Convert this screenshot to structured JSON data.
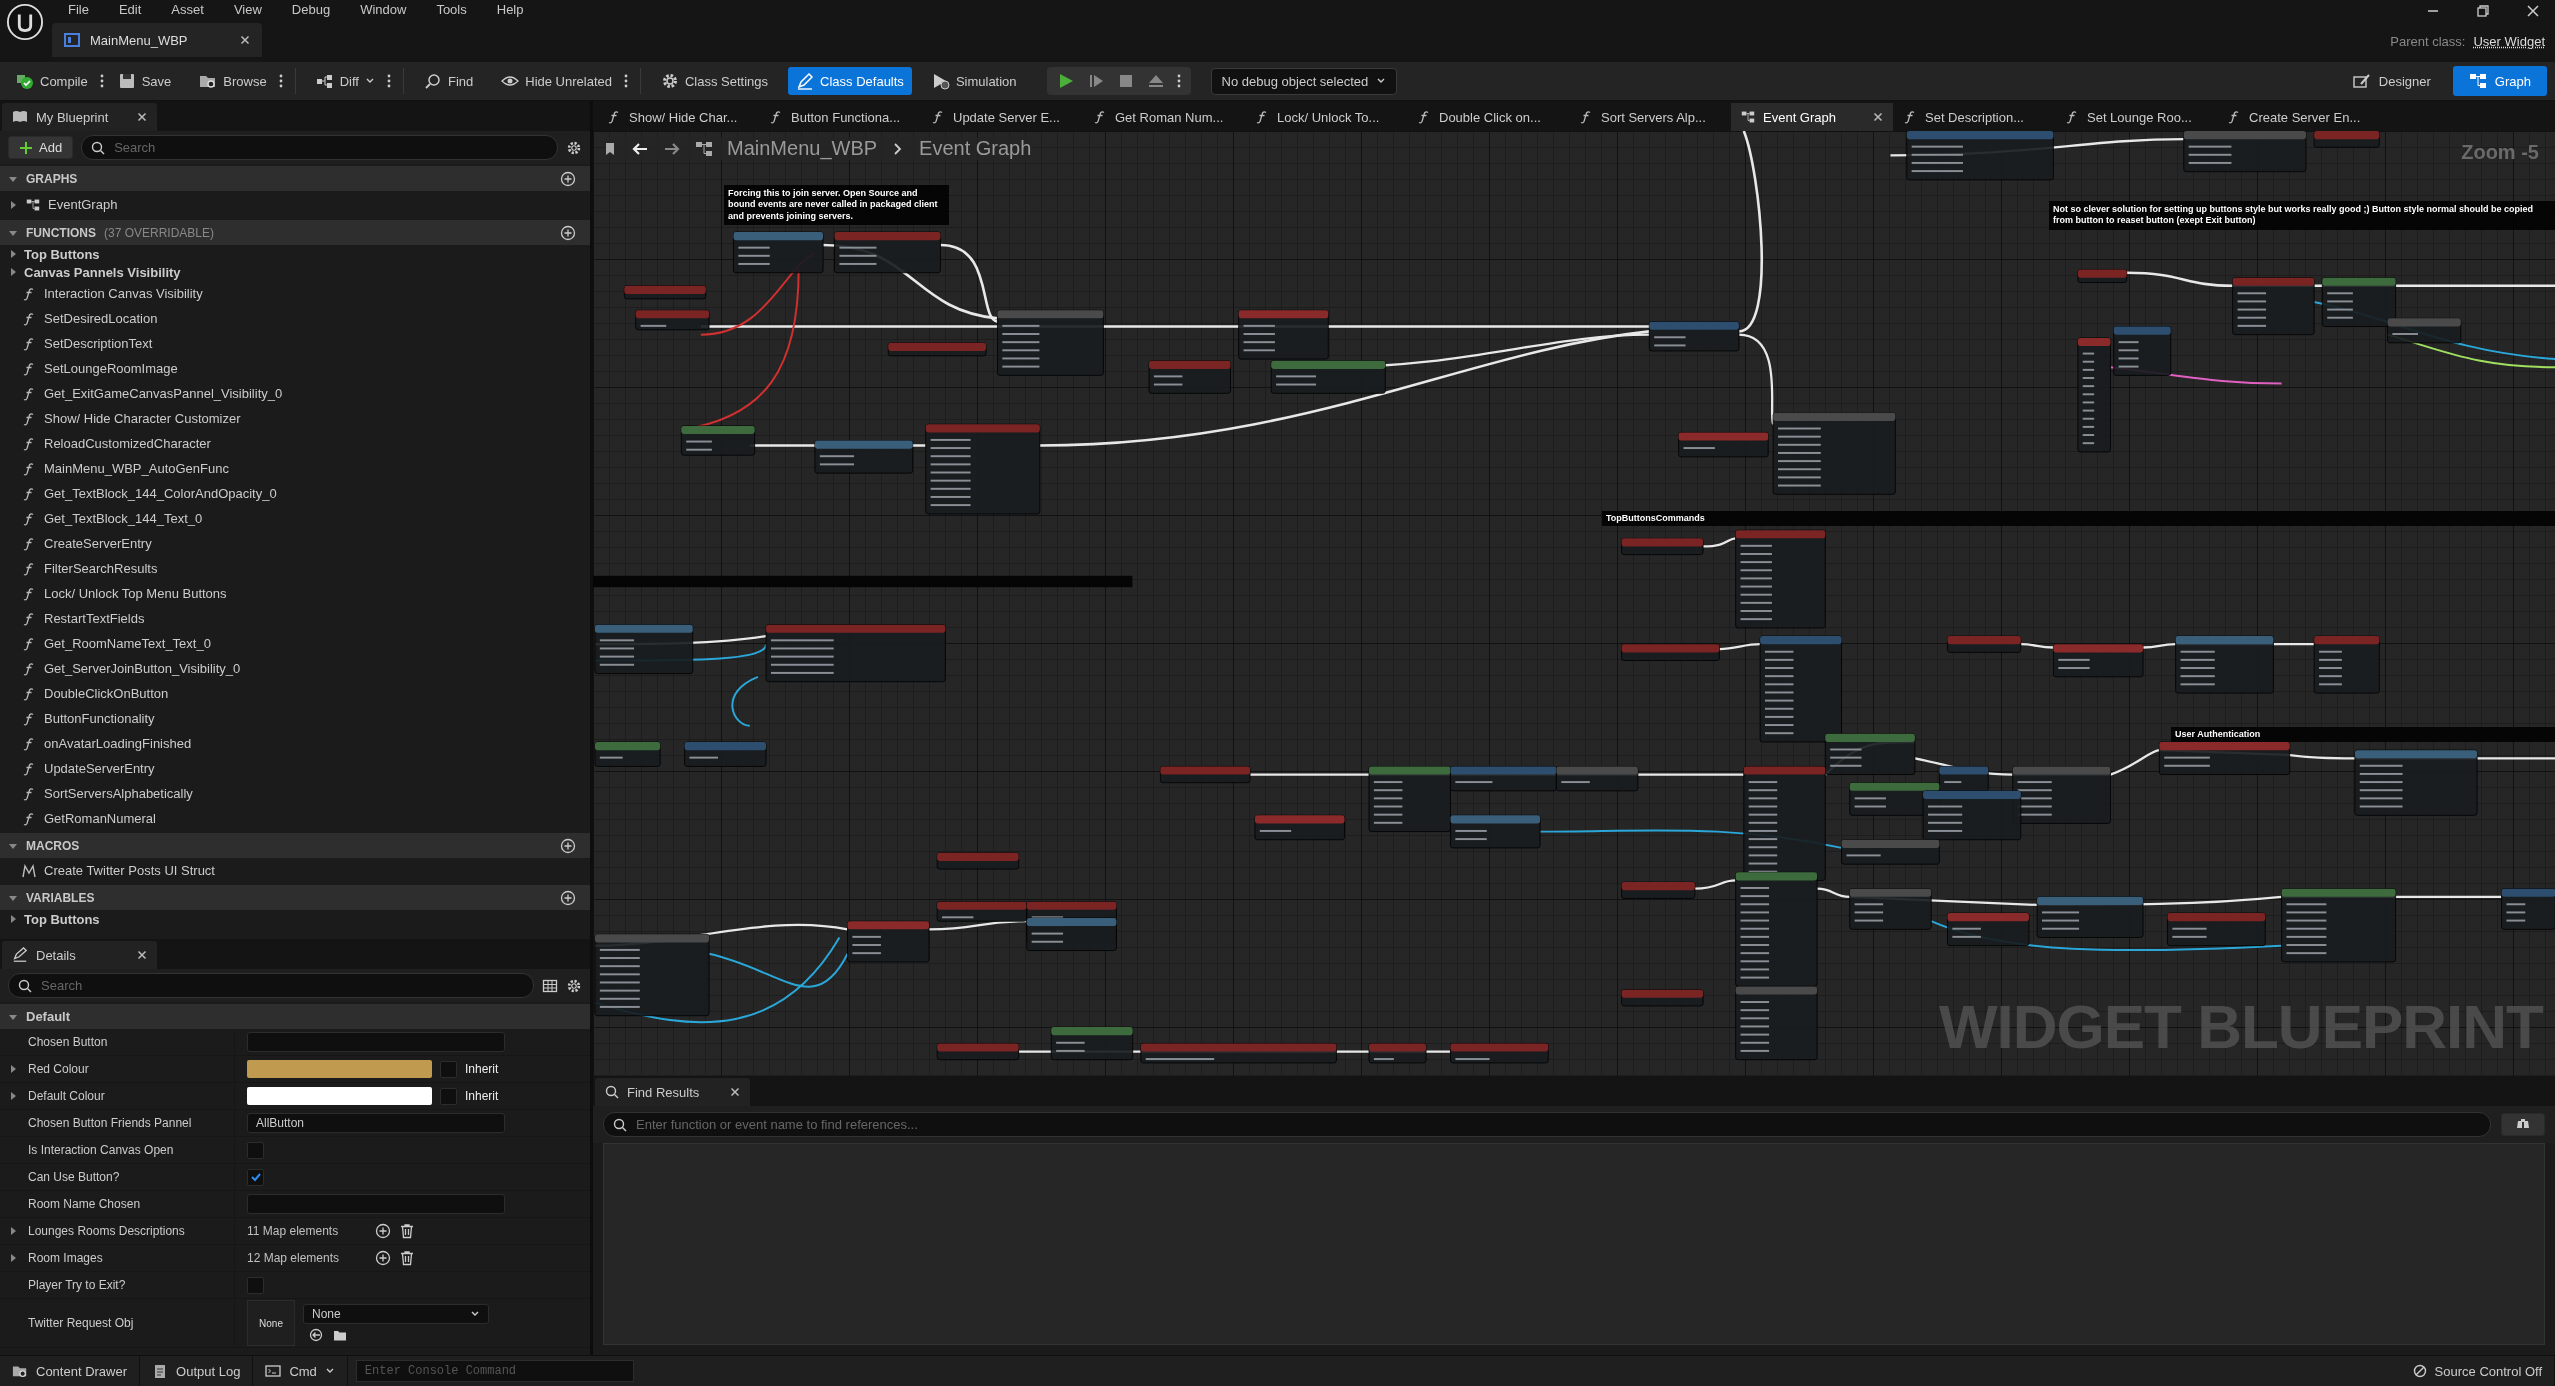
{
  "menu": [
    "File",
    "Edit",
    "Asset",
    "View",
    "Debug",
    "Window",
    "Tools",
    "Help"
  ],
  "asset_tab": {
    "title": "MainMenu_WBP"
  },
  "parent_class": {
    "label": "Parent class:",
    "value": "User Widget"
  },
  "toolbar": [
    {
      "kind": "compile",
      "label": "Compile",
      "selected": false,
      "more": true
    },
    {
      "kind": "save",
      "label": "Save",
      "selected": false,
      "more": false
    },
    {
      "kind": "browse",
      "label": "Browse",
      "selected": false,
      "more": true
    },
    {
      "kind": "diff",
      "label": "Diff",
      "selected": false,
      "more": true
    },
    {
      "kind": "find",
      "label": "Find",
      "selected": false,
      "more": false
    },
    {
      "kind": "hide",
      "label": "Hide Unrelated",
      "selected": false,
      "more": true
    },
    {
      "kind": "settings",
      "label": "Class Settings",
      "selected": false,
      "more": false
    },
    {
      "kind": "defaults",
      "label": "Class Defaults",
      "selected": true,
      "more": false
    },
    {
      "kind": "simulation",
      "label": "Simulation",
      "selected": false,
      "more": false
    }
  ],
  "debug_dropdown": {
    "value": "No debug object selected"
  },
  "modes": [
    {
      "label": "Designer",
      "selected": false
    },
    {
      "label": "Graph",
      "selected": true
    }
  ],
  "my_blueprint": {
    "tab": "My Blueprint",
    "add_button": "Add",
    "search": {
      "placeholder": "Search"
    },
    "sections": [
      {
        "title": "GRAPHS",
        "items": [
          {
            "kind": "graph",
            "label": "EventGraph"
          }
        ]
      },
      {
        "title": "FUNCTIONS",
        "note": "(37 OVERRIDABLE)",
        "items": [
          {
            "kind": "category",
            "label": "Top Buttons"
          },
          {
            "kind": "category",
            "label": "Canvas Pannels Visibility"
          },
          {
            "kind": "function",
            "label": "Interaction Canvas Visibility"
          },
          {
            "kind": "function",
            "label": "SetDesiredLocation"
          },
          {
            "kind": "function",
            "label": "SetDescriptionText"
          },
          {
            "kind": "function",
            "label": "SetLoungeRoomImage"
          },
          {
            "kind": "function",
            "label": "Get_ExitGameCanvasPannel_Visibility_0"
          },
          {
            "kind": "function",
            "label": "Show/ Hide Character Customizer"
          },
          {
            "kind": "function",
            "label": "ReloadCustomizedCharacter"
          },
          {
            "kind": "function",
            "label": "MainMenu_WBP_AutoGenFunc"
          },
          {
            "kind": "function",
            "label": "Get_TextBlock_144_ColorAndOpacity_0"
          },
          {
            "kind": "function",
            "label": "Get_TextBlock_144_Text_0"
          },
          {
            "kind": "function",
            "label": "CreateServerEntry"
          },
          {
            "kind": "function",
            "label": "FilterSearchResults"
          },
          {
            "kind": "function",
            "label": "Lock/ Unlock Top Menu Buttons"
          },
          {
            "kind": "function",
            "label": "RestartTextFields"
          },
          {
            "kind": "function",
            "label": "Get_RoomNameText_Text_0"
          },
          {
            "kind": "function",
            "label": "Get_ServerJoinButton_Visibility_0"
          },
          {
            "kind": "function",
            "label": "DoubleClickOnButton"
          },
          {
            "kind": "function",
            "label": "ButtonFunctionality"
          },
          {
            "kind": "function",
            "label": "onAvatarLoadingFinished"
          },
          {
            "kind": "function",
            "label": "UpdateServerEntry"
          },
          {
            "kind": "function",
            "label": "SortServersAlphabetically"
          },
          {
            "kind": "function",
            "label": "GetRomanNumeral"
          }
        ]
      },
      {
        "title": "MACROS",
        "items": [
          {
            "kind": "macro",
            "label": "Create Twitter Posts UI Struct"
          }
        ]
      },
      {
        "title": "VARIABLES",
        "items": [
          {
            "kind": "category",
            "label": "Top Buttons"
          }
        ]
      }
    ]
  },
  "details": {
    "tab": "Details",
    "search": {
      "placeholder": "Search"
    },
    "section": "Default",
    "properties": [
      {
        "kind": "text",
        "label": "Chosen Button",
        "expandable": false
      },
      {
        "kind": "color",
        "label": "Red Colour",
        "color": "#bf9a4f",
        "inherit": "Inherit",
        "inherit_checked": false,
        "expandable": true
      },
      {
        "kind": "color",
        "label": "Default Colour",
        "color": "#ffffff",
        "inherit": "Inherit",
        "inherit_checked": false,
        "expandable": true
      },
      {
        "kind": "text",
        "label": "Chosen Button Friends Pannel",
        "value": "AllButton",
        "expandable": false
      },
      {
        "kind": "checkbox",
        "label": "Is Interaction Canvas Open",
        "checked": false,
        "expandable": false
      },
      {
        "kind": "checkbox",
        "label": "Can Use Button?",
        "checked": true,
        "expandable": false
      },
      {
        "kind": "text",
        "label": "Room Name Chosen",
        "expandable": false
      },
      {
        "kind": "map",
        "label": "Lounges Rooms Descriptions",
        "value": "11 Map elements",
        "expandable": true
      },
      {
        "kind": "map",
        "label": "Room Images",
        "value": "12 Map elements",
        "expandable": true
      },
      {
        "kind": "checkbox",
        "label": "Player Try to Exit?",
        "checked": false,
        "expandable": false
      },
      {
        "kind": "object",
        "label": "Twitter Request Obj",
        "thumb": "None",
        "value": "None",
        "expandable": false
      }
    ]
  },
  "graph_tabs": [
    {
      "kind": "function",
      "label": "Show/ Hide Char...",
      "selected": false
    },
    {
      "kind": "function",
      "label": "Button Functiona...",
      "selected": false
    },
    {
      "kind": "function",
      "label": "Update Server E...",
      "selected": false
    },
    {
      "kind": "function",
      "label": "Get Roman Num...",
      "selected": false
    },
    {
      "kind": "function",
      "label": "Lock/ Unlock To...",
      "selected": false
    },
    {
      "kind": "function",
      "label": "Double Click on...",
      "selected": false
    },
    {
      "kind": "function",
      "label": "Sort Servers Alp...",
      "selected": false
    },
    {
      "kind": "graph",
      "label": "Event Graph",
      "selected": true
    },
    {
      "kind": "function",
      "label": "Set Description...",
      "selected": false
    },
    {
      "kind": "function",
      "label": "Set Lounge Roo...",
      "selected": false
    },
    {
      "kind": "function",
      "label": "Create Server En...",
      "selected": false
    }
  ],
  "breadcrumb": [
    "MainMenu_WBP",
    "Event Graph"
  ],
  "canvas": {
    "zoom": "Zoom -5",
    "watermark": "WIDGET BLUEPRINT",
    "comments": [
      {
        "text": "Forcing this to join server. Open Source and bound events are never called in packaged client and prevents joining servers."
      },
      {
        "text": "Not so clever solution for setting up buttons style but works really good ;) Button style normal should be copied from button to reaset button (exept Exit button)"
      },
      {
        "text": "TopButtonsCommands"
      },
      {
        "text": "User Authentication"
      }
    ]
  },
  "find_results": {
    "tab": "Find Results",
    "search": {
      "placeholder": "Enter function or event name to find references..."
    }
  },
  "status_bar": {
    "content_drawer": "Content Drawer",
    "output_log": "Output Log",
    "cmd": "Cmd",
    "console": {
      "placeholder": "Enter Console Command"
    },
    "source_control": "Source Control Off"
  }
}
